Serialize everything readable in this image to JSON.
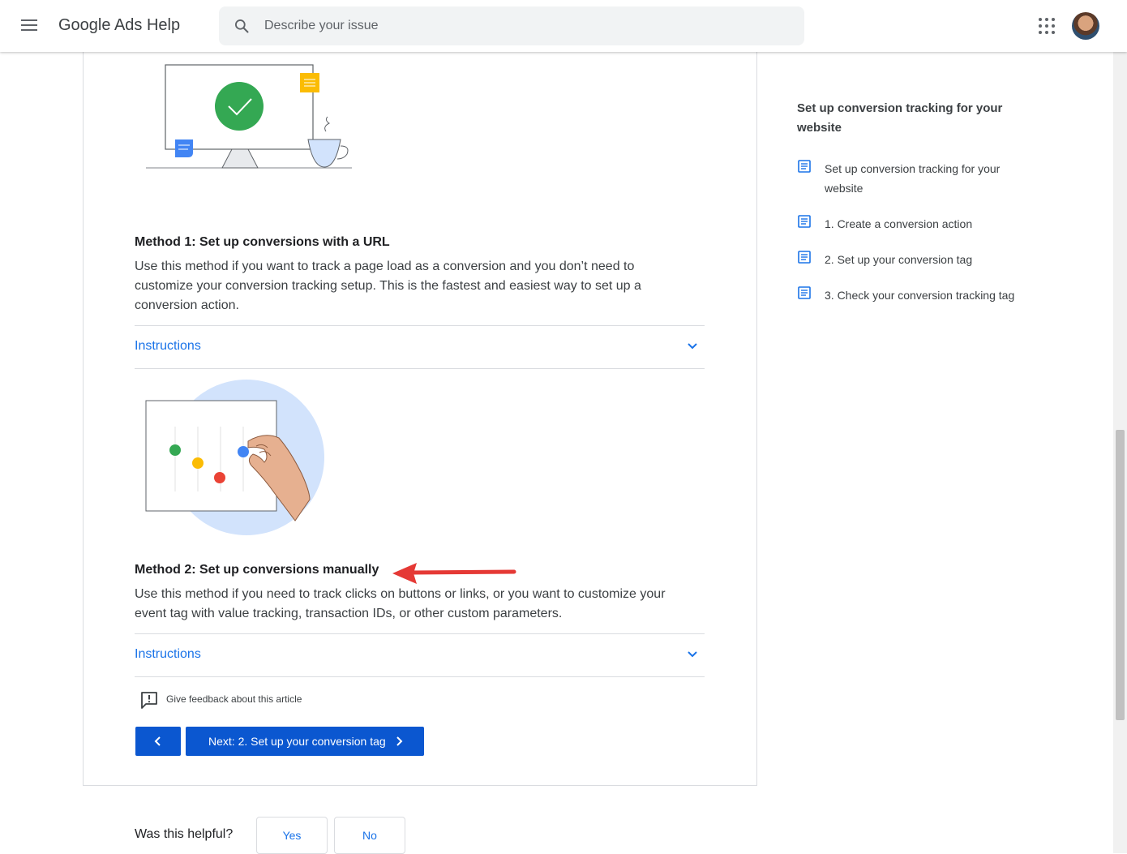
{
  "header": {
    "title": "Google Ads Help",
    "search_placeholder": "Describe your issue"
  },
  "article": {
    "method1": {
      "title": "Method 1: Set up conversions with a URL",
      "description": "Use this method if you want to track a page load as a conversion and you don’t need to customize your conversion tracking setup. This is the fastest and easiest way to set up a conversion action.",
      "accordion_label": "Instructions"
    },
    "method2": {
      "title": "Method 2: Set up conversions manually",
      "description": "Use this method if you need to track clicks on buttons or links, or you want to customize your event tag with value tracking, transaction IDs, or other custom parameters.",
      "accordion_label": "Instructions"
    },
    "feedback_label": "Give feedback about this article",
    "next_button_label": "Next: 2. Set up your conversion tag",
    "helpful": {
      "question": "Was this helpful?",
      "yes": "Yes",
      "no": "No"
    }
  },
  "sidebar": {
    "title": "Set up conversion tracking for your website",
    "items": [
      {
        "label": "Set up conversion tracking for your website"
      },
      {
        "label": "1. Create a conversion action"
      },
      {
        "label": "2. Set up your conversion tag"
      },
      {
        "label": "3. Check your conversion tracking tag"
      }
    ]
  },
  "colors": {
    "link_blue": "#1a73e8",
    "button_blue": "#0b57d0",
    "annotation_arrow": "#e53935",
    "success_green": "#34a853"
  },
  "icons": [
    "menu-icon",
    "search-icon",
    "apps-grid-icon",
    "user-avatar",
    "chevron-down-icon",
    "feedback-icon",
    "chevron-left-icon",
    "chevron-right-icon",
    "document-icon"
  ]
}
